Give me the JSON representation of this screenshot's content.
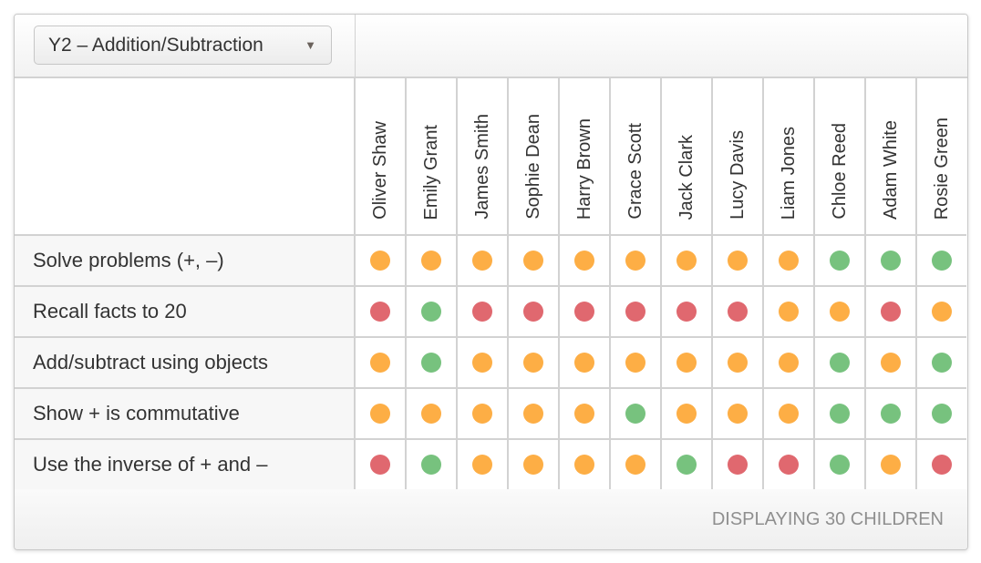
{
  "assessment_select": {
    "value": "Y2 – Addition/Subtraction",
    "icon": "triangle-down-icon"
  },
  "students": [
    "Oliver Shaw",
    "Emily Grant",
    "James Smith",
    "Sophie Dean",
    "Harry Brown",
    "Grace Scott",
    "Jack Clark",
    "Lucy Davis",
    "Liam Jones",
    "Chloe Reed",
    "Adam White",
    "Rosie Green"
  ],
  "status_colors": {
    "R": "#e0686f",
    "O": "#fdae45",
    "G": "#77c27e"
  },
  "objectives": [
    {
      "label": "Solve problems (+, –)",
      "statuses": [
        "O",
        "O",
        "O",
        "O",
        "O",
        "O",
        "O",
        "O",
        "O",
        "G",
        "G",
        "G"
      ]
    },
    {
      "label": "Recall facts to 20",
      "statuses": [
        "R",
        "G",
        "R",
        "R",
        "R",
        "R",
        "R",
        "R",
        "O",
        "O",
        "R",
        "O"
      ]
    },
    {
      "label": "Add/subtract using objects",
      "statuses": [
        "O",
        "G",
        "O",
        "O",
        "O",
        "O",
        "O",
        "O",
        "O",
        "G",
        "O",
        "G"
      ]
    },
    {
      "label": "Show + is commutative",
      "statuses": [
        "O",
        "O",
        "O",
        "O",
        "O",
        "G",
        "O",
        "O",
        "O",
        "G",
        "G",
        "G"
      ]
    },
    {
      "label": "Use the inverse of + and –",
      "statuses": [
        "R",
        "G",
        "O",
        "O",
        "O",
        "O",
        "G",
        "R",
        "R",
        "G",
        "O",
        "R"
      ]
    }
  ],
  "footer": {
    "status": "DISPLAYING 30 CHILDREN"
  }
}
